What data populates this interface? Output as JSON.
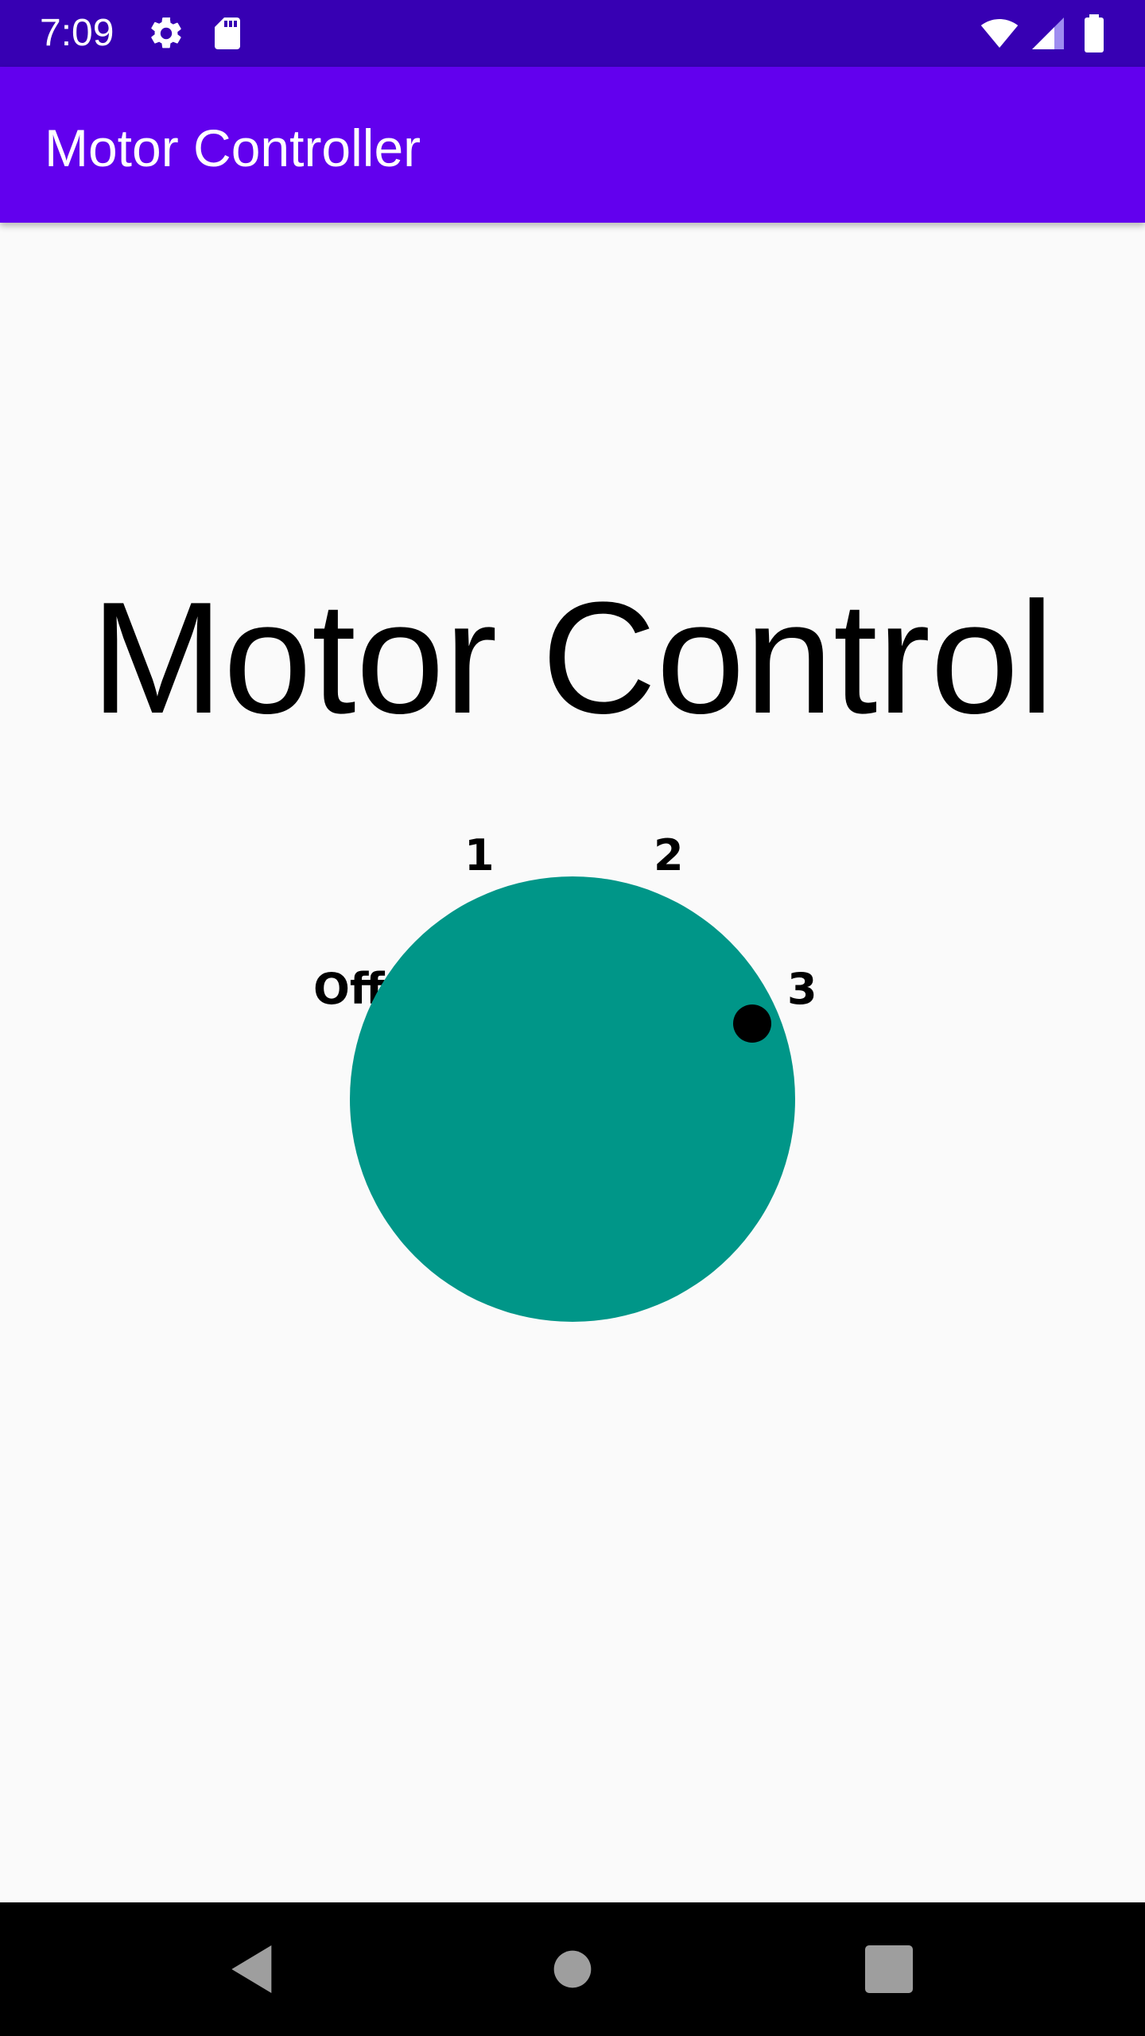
{
  "status_bar": {
    "time": "7:09",
    "icons": [
      "settings-icon",
      "sd-card-icon",
      "wifi-icon",
      "cell-signal-icon",
      "battery-icon"
    ]
  },
  "app_bar": {
    "title": "Motor Controller"
  },
  "main": {
    "heading": "Motor Control",
    "dial": {
      "labels": {
        "off": "Off",
        "one": "1",
        "two": "2",
        "three": "3"
      },
      "selected_setting": "3"
    }
  },
  "nav_bar": {
    "icons": [
      "back-icon",
      "home-icon",
      "recents-icon"
    ]
  },
  "colors": {
    "status_bar": "#3700b3",
    "app_bar": "#6200ee",
    "dial": "#009688",
    "background": "#fafafa",
    "indicator": "#000000"
  }
}
